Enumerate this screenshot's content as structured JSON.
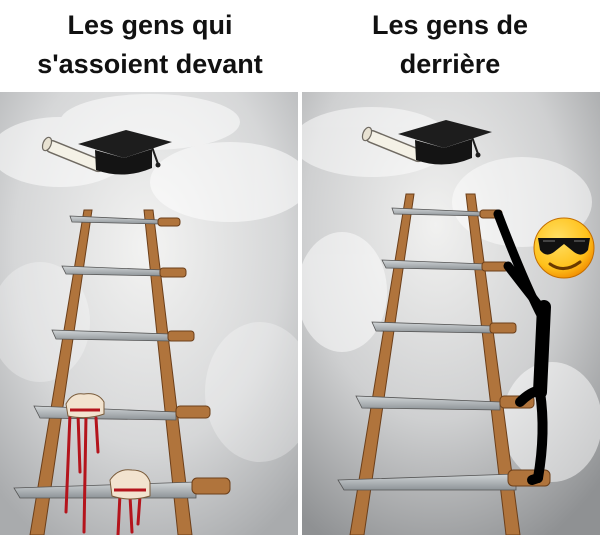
{
  "left_panel": {
    "caption_line1": "Les gens qui",
    "caption_line2": "s'assoient devant",
    "items": [
      "graduation-cap",
      "diploma-scroll",
      "wooden-ladder",
      "knife-rungs",
      "bleeding-hands"
    ]
  },
  "right_panel": {
    "caption_line1": "Les gens de",
    "caption_line2": "derrière",
    "items": [
      "graduation-cap",
      "diploma-scroll",
      "wooden-ladder",
      "knife-rungs",
      "stick-figure",
      "sunglasses-emoji"
    ]
  },
  "colors": {
    "wood": "#b0743c",
    "blade": "#aeb3b6",
    "blood": "#b4141c",
    "sky": "#d9dadb",
    "emoji": "#ffc21c"
  }
}
